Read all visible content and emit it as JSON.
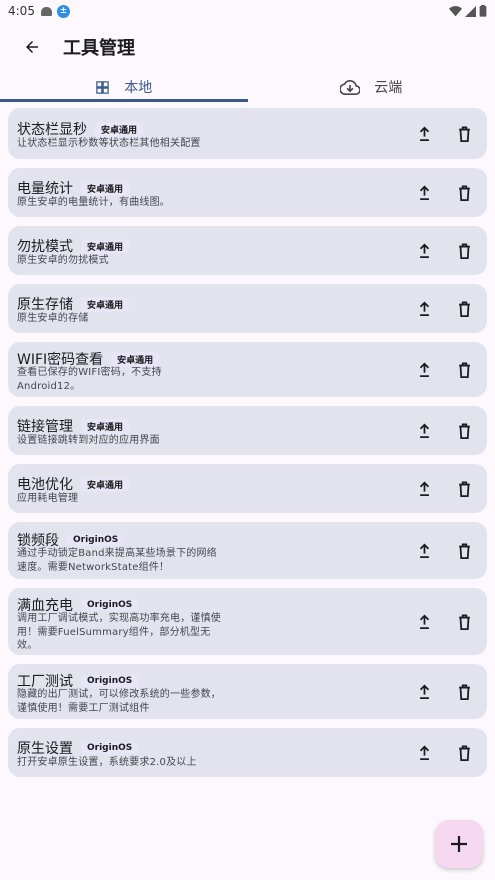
{
  "status_bar": {
    "time": "4:05",
    "notification_badge": "±"
  },
  "app_bar": {
    "title": "工具管理"
  },
  "tabs": [
    {
      "label": "本地",
      "icon": "grid-icon",
      "active": true
    },
    {
      "label": "云端",
      "icon": "cloud-download-icon",
      "active": false
    }
  ],
  "tools": [
    {
      "title": "状态栏显秒",
      "tag": "安卓通用",
      "desc": "让状态栏显示秒数等状态栏其他相关配置"
    },
    {
      "title": "电量统计",
      "tag": "安卓通用",
      "desc": "原生安卓的电量统计，有曲线图。"
    },
    {
      "title": "勿扰模式",
      "tag": "安卓通用",
      "desc": "原生安卓的勿扰模式"
    },
    {
      "title": "原生存储",
      "tag": "安卓通用",
      "desc": "原生安卓的存储"
    },
    {
      "title": "WIFI密码查看",
      "tag": "安卓通用",
      "desc": "查看已保存的WIFI密码，不支持Android12。"
    },
    {
      "title": "链接管理",
      "tag": "安卓通用",
      "desc": "设置链接跳转到对应的应用界面"
    },
    {
      "title": "电池优化",
      "tag": "安卓通用",
      "desc": "应用耗电管理"
    },
    {
      "title": "锁频段",
      "tag": "OriginOS",
      "desc": "通过手动锁定Band来提高某些场景下的网络速度。需要NetworkState组件！"
    },
    {
      "title": "满血充电",
      "tag": "OriginOS",
      "desc": "调用工厂调试模式，实现高功率充电，谨慎使用！需要FuelSummary组件，部分机型无效。"
    },
    {
      "title": "工厂测试",
      "tag": "OriginOS",
      "desc": "隐藏的出厂测试，可以修改系统的一些参数，谨慎使用！需要工厂测试组件"
    },
    {
      "title": "原生设置",
      "tag": "OriginOS",
      "desc": "打开安卓原生设置，系统要求2.0及以上"
    }
  ],
  "colors": {
    "accent": "#3a5a8c",
    "card": "#e3e3ee",
    "fab": "#f6d9f0",
    "background": "#fdf8fd"
  }
}
